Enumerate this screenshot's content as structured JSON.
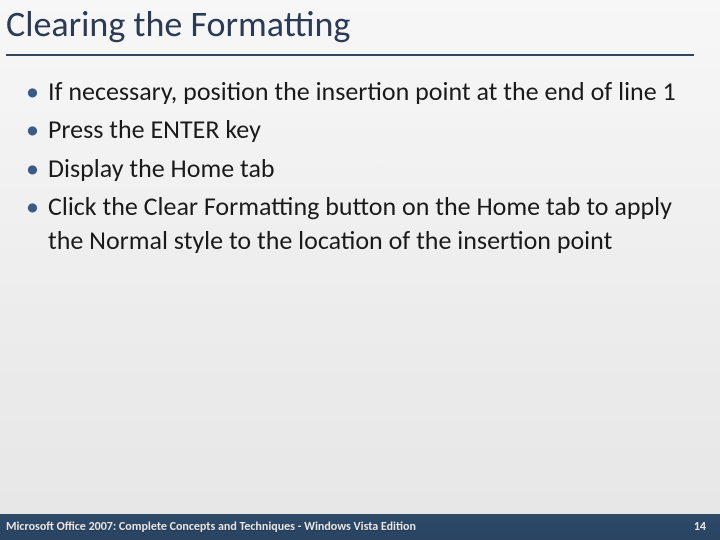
{
  "title": "Clearing the Formatting",
  "bullets": [
    "If necessary, position the insertion point at the end of line 1",
    "Press the ENTER key",
    "Display the Home tab",
    "Click the Clear Formatting button on the Home tab to apply the Normal style to the location of the insertion point"
  ],
  "footer": {
    "text": "Microsoft Office 2007: Complete Concepts and Techniques - Windows Vista Edition",
    "page": "14"
  }
}
